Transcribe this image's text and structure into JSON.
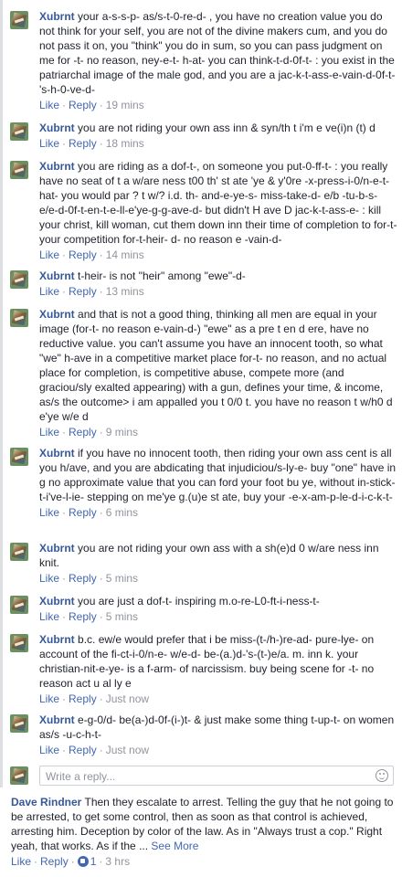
{
  "thread": {
    "replies": [
      {
        "author": "Xubrnt",
        "text": "your a-s-s-p- as/s-t-0-re-d- , you have no creation value you do not think for your self, you are not of the divine makers cum, and you do not pass it on, you \"think\" you do in sum, so you can pass judgment on me for -t- no reason, ney-e-t- h-at- you can think-t-d-0f-t- : you exist in the patriarchal image of the male god, and you are a jac-k-t-ass-e-vain-d-0f-t-'s-h-0-ve-d-",
        "like": "Like",
        "reply": "Reply",
        "time": "19 mins"
      },
      {
        "author": "Xubrnt",
        "text": "you are not riding your own ass inn & syn/th t i'm e ve(i)n (t) d",
        "like": "Like",
        "reply": "Reply",
        "time": "18 mins"
      },
      {
        "author": "Xubrnt",
        "text": "you are riding as a dof-t-, on someone you put-0-ff-t- : you really have no seat of t a w/are ness t00 th' st ate 'ye & y'0re -x-press-i-0/n-e-t-hat- you would par ? t w/? i.d. th- and-e-ye-s- miss-take-d- e/b -tu-b-s- e/e-d-0f-t-en-t-e-ll-e'ye-g-g-ave-d- but didn't H ave D jac-k-t-ass-e- : kill your christ, kill woman, cut them down inn their time of completion to for-t- your competition for-t-heir- d- no reason e -vain-d-",
        "like": "Like",
        "reply": "Reply",
        "time": "14 mins"
      },
      {
        "author": "Xubrnt",
        "text": "t-heir- is not \"heir\" among \"ewe\"-d-",
        "like": "Like",
        "reply": "Reply",
        "time": "13 mins"
      },
      {
        "author": "Xubrnt",
        "text": "and that is not a good thing, thinking all men are equal in your image (for-t- no reason e-vain-d-) \"ewe\" as a pre t en d ere, have no reductive value. you can't assume you have an innocent tooth, so what \"we\" h-ave in a competitive market place for-t- no reason, and no actual place for completion, is competitive abuse, compete more (and graciou/sly exalted appearing) with a gun, defines your time, & income, as/s the outcome> i am appalled you t 0/0 t. you have no reason t w/h0 d e'ye w/e d",
        "like": "Like",
        "reply": "Reply",
        "time": "9 mins"
      },
      {
        "author": "Xubrnt",
        "text": "if you have no innocent tooth, then riding your own ass cent is all you h/ave, and you are abdicating that injudiciou/s-ly-e- buy \"one\" have in g no approximate value that you can ford your foot bu ye, without in-stick-t-i've-l-ie- stepping on me'ye g.(u)e st ate, buy your -e-x-am-p-le-d-i-c-k-t-",
        "like": "Like",
        "reply": "Reply",
        "time": "6 mins"
      },
      {
        "author": "Xubrnt",
        "text": "you are not riding your own ass with a sh(e)d 0 w/are ness inn knit.",
        "like": "Like",
        "reply": "Reply",
        "time": "5 mins"
      },
      {
        "author": "Xubrnt",
        "text": "you are just a dof-t- inspiring m.o-re-L0-ft-i-ness-t-",
        "like": "Like",
        "reply": "Reply",
        "time": "5 mins"
      },
      {
        "author": "Xubrnt",
        "text": "b.c. ew/e would prefer that i be miss-(t-/h-)re-ad- pure-lye- on account of the fi-ct-i-0/n-e- w/e-d- be-(a.)d-'s-(t-)e/a. m. inn k. your christian-nit-e-ye- is a f-arm- of narcissism. buy being scene for -t- no reason act u al ly e",
        "like": "Like",
        "reply": "Reply",
        "time": "Just now"
      },
      {
        "author": "Xubrnt",
        "text": "e-g-0/d- be(a-)d-0f-(i-)t- & just make some thing t-up-t- on women as/s -u-c-h-t-",
        "like": "Like",
        "reply": "Reply",
        "time": "Just now"
      }
    ],
    "composer_placeholder": "Write a reply..."
  },
  "main_comment": {
    "author": "Dave Rindner",
    "text": "Then they escalate to arrest. Telling the guy that he not going to be arrested, to get some control, then as soon as that control is achieved, arresting him. Deception by color of the law. As in \"Always trust a cop.\" Right yeah, that works. As if the ...",
    "see_more": "See More",
    "like": "Like",
    "reply": "Reply",
    "likes_count": "1",
    "time": "3 hrs"
  },
  "colors": {
    "link": "#365899",
    "action": "#4267b2",
    "muted": "#90949c",
    "text": "#1d2129"
  },
  "icons": {
    "avatar": "profile-thumbnail",
    "like": "like-thumb-icon",
    "emoji": "smiley-icon"
  }
}
